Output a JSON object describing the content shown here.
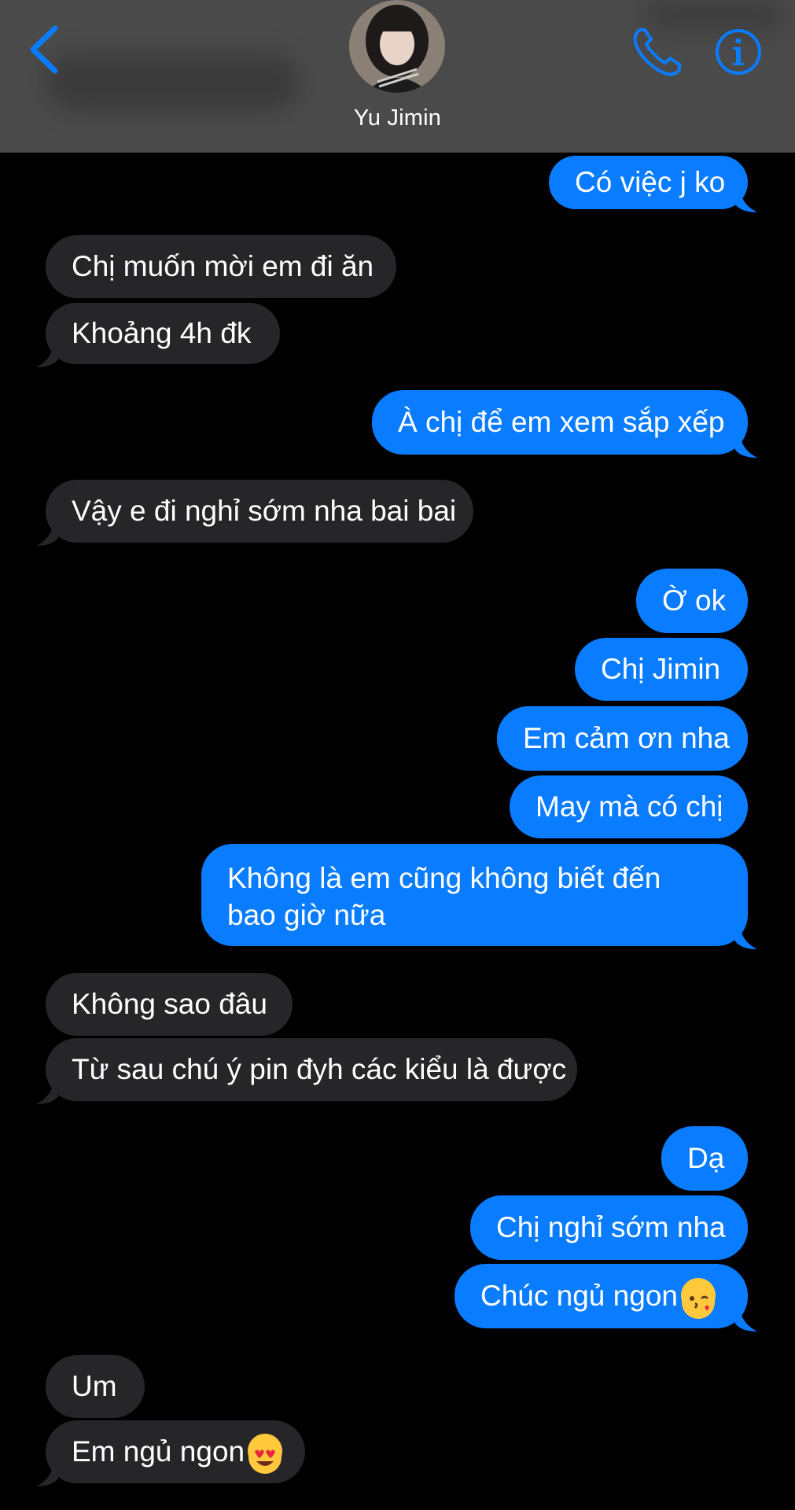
{
  "header": {
    "contact_name": "Yu Jimin",
    "accent_color": "#0a7cff",
    "icons": [
      "chevron-left-icon",
      "phone-icon",
      "info-icon"
    ]
  },
  "messages": [
    {
      "side": "out",
      "text": "Có việc j ko"
    },
    {
      "side": "in",
      "text": "Chị muốn mời em đi ăn"
    },
    {
      "side": "in",
      "text": "Khoảng 4h đk"
    },
    {
      "side": "out",
      "text": "À chị để em xem sắp xếp"
    },
    {
      "side": "in",
      "text": "Vậy e đi nghỉ sớm nha bai bai"
    },
    {
      "side": "out",
      "text": "Ờ ok"
    },
    {
      "side": "out",
      "text": "Chị Jimin"
    },
    {
      "side": "out",
      "text": "Em cảm ơn nha"
    },
    {
      "side": "out",
      "text": "May mà có chị"
    },
    {
      "side": "out",
      "text": "Không là em cũng không biết đến bao giờ nữa"
    },
    {
      "side": "in",
      "text": "Không sao đâu"
    },
    {
      "side": "in",
      "text": "Từ sau chú ý pin đyh các kiểu là được"
    },
    {
      "side": "out",
      "text": "Dạ"
    },
    {
      "side": "out",
      "text": "Chị nghỉ sớm nha"
    },
    {
      "side": "out",
      "text": "Chúc ngủ ngon",
      "emoji": "face-blowing-kiss-emoji"
    },
    {
      "side": "in",
      "text": "Um"
    },
    {
      "side": "in",
      "text": "Em ngủ ngon",
      "emoji": "heart-eyes-emoji"
    }
  ]
}
